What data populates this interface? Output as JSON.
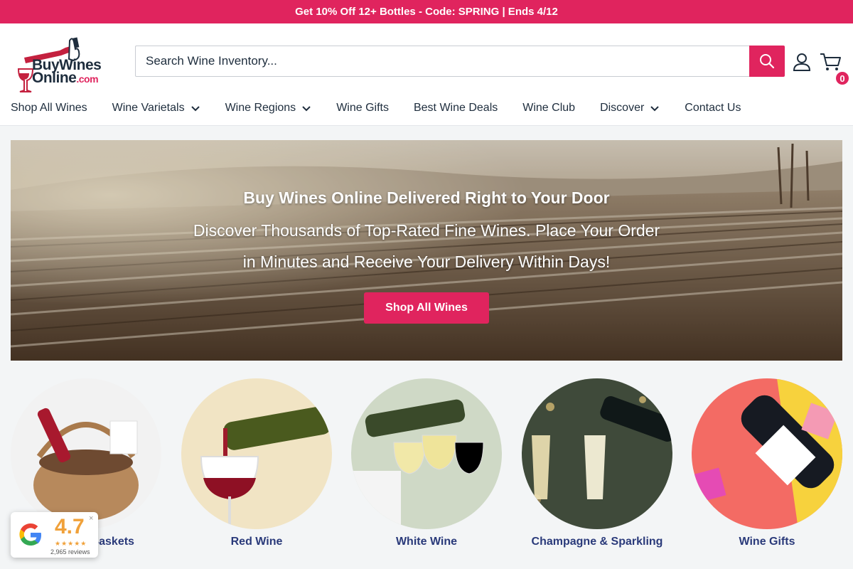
{
  "promo": {
    "text": "Get 10% Off 12+ Bottles - Code: SPRING | Ends 4/12"
  },
  "logo": {
    "line1": "BuyWines",
    "line2": "Online",
    "suffix": ".com"
  },
  "search": {
    "placeholder": "Search Wine Inventory..."
  },
  "cart": {
    "count": "0"
  },
  "nav": {
    "items": [
      {
        "label": "Shop All Wines",
        "dropdown": false
      },
      {
        "label": "Wine Varietals",
        "dropdown": true
      },
      {
        "label": "Wine Regions",
        "dropdown": true
      },
      {
        "label": "Wine Gifts",
        "dropdown": false
      },
      {
        "label": "Best Wine Deals",
        "dropdown": false
      },
      {
        "label": "Wine Club",
        "dropdown": false
      },
      {
        "label": "Discover",
        "dropdown": true
      },
      {
        "label": "Contact Us",
        "dropdown": false
      }
    ]
  },
  "hero": {
    "title": "Buy Wines Online Delivered Right to Your Door",
    "subtitle": "Discover Thousands of Top-Rated Fine Wines. Place Your Order in Minutes and Receive Your Delivery Within Days!",
    "button": "Shop All Wines"
  },
  "categories": [
    {
      "label": "Wine Gift Baskets"
    },
    {
      "label": "Red Wine"
    },
    {
      "label": "White Wine"
    },
    {
      "label": "Champagne & Sparkling"
    },
    {
      "label": "Wine Gifts"
    }
  ],
  "review": {
    "score": "4.7",
    "stars": "★★★★★",
    "count": "2,965 reviews",
    "close": "×"
  },
  "colors": {
    "brand": "#e0245e",
    "text": "#1e2d3d",
    "category_link": "#2a3a7a",
    "star": "#f0a13a"
  }
}
